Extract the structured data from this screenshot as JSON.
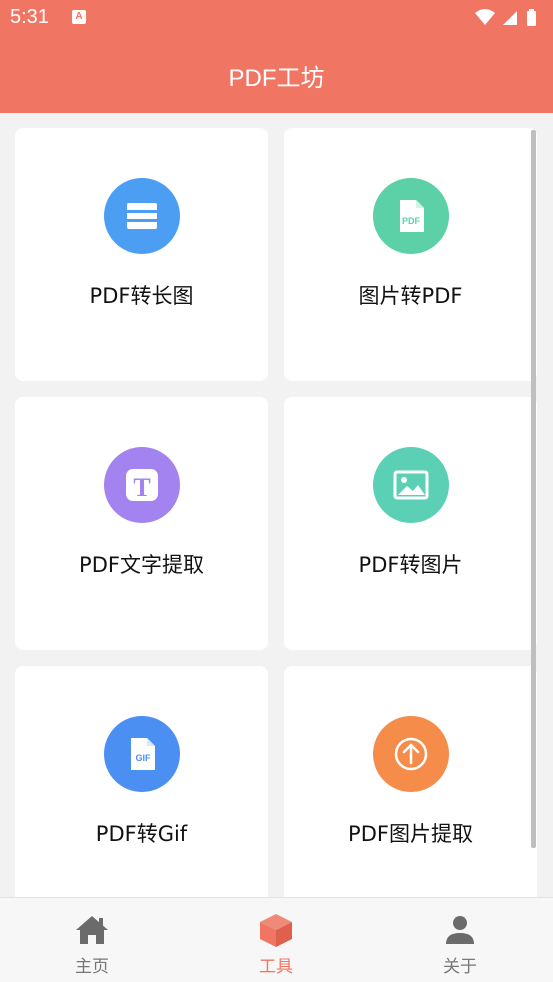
{
  "status_bar": {
    "time": "5:31",
    "notification_glyph": "A"
  },
  "app_bar": {
    "title": "PDF工坊"
  },
  "tools": [
    {
      "label": "PDF转长图",
      "icon": "long-image-icon",
      "color": "#4c9ef2"
    },
    {
      "label": "图片转PDF",
      "icon": "pdf-file-icon",
      "color": "#5cd0a7"
    },
    {
      "label": "PDF文字提取",
      "icon": "text-t-icon",
      "color": "#a283f0"
    },
    {
      "label": "PDF转图片",
      "icon": "picture-icon",
      "color": "#5cd0b5"
    },
    {
      "label": "PDF转Gif",
      "icon": "gif-file-icon",
      "color": "#4c8ff2"
    },
    {
      "label": "PDF图片提取",
      "icon": "upload-arrow-icon",
      "color": "#f58c4a"
    }
  ],
  "gif_badge": "GIF",
  "pdf_badge": "PDF",
  "text_badge": "T",
  "tab_bar": {
    "tabs": [
      {
        "label": "主页",
        "icon": "home-icon"
      },
      {
        "label": "工具",
        "icon": "box-icon",
        "active": true
      },
      {
        "label": "关于",
        "icon": "person-icon"
      }
    ]
  },
  "colors": {
    "accent": "#f07563",
    "background": "#f2f2f2",
    "inactive_tab": "#777777"
  }
}
